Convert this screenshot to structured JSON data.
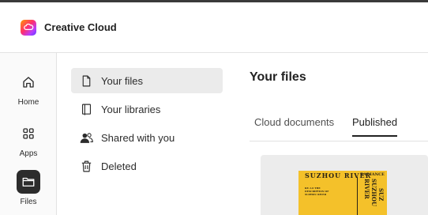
{
  "app": {
    "title": "Creative Cloud",
    "logo_icon": "creative-cloud-logo-icon",
    "brand_gradient": [
      "#ff9a00",
      "#ff2e6e",
      "#b83dff",
      "#5a3dff"
    ]
  },
  "rail": {
    "items": [
      {
        "label": "Home",
        "icon": "home-icon",
        "active": false
      },
      {
        "label": "Apps",
        "icon": "apps-grid-icon",
        "active": false
      },
      {
        "label": "Files",
        "icon": "folder-icon",
        "active": true
      }
    ]
  },
  "filenav": {
    "items": [
      {
        "label": "Your files",
        "icon": "file-icon",
        "active": true
      },
      {
        "label": "Your libraries",
        "icon": "libraries-icon",
        "active": false
      },
      {
        "label": "Shared with you",
        "icon": "shared-users-icon",
        "active": false
      },
      {
        "label": "Deleted",
        "icon": "trash-icon",
        "active": false
      }
    ]
  },
  "main": {
    "title": "Your files",
    "tabs": [
      {
        "label": "Cloud documents",
        "active": false
      },
      {
        "label": "Published",
        "active": true
      }
    ]
  },
  "card": {
    "thumbnail_text": {
      "headline": "SUZHOU RIVER",
      "small": "RADIANCE",
      "vertical": "SUZHOU RIVER",
      "vertical2": "SUZ",
      "caption": "RE-1.0 THE DESCRIPTION OF SUZHOU RIVER"
    }
  }
}
